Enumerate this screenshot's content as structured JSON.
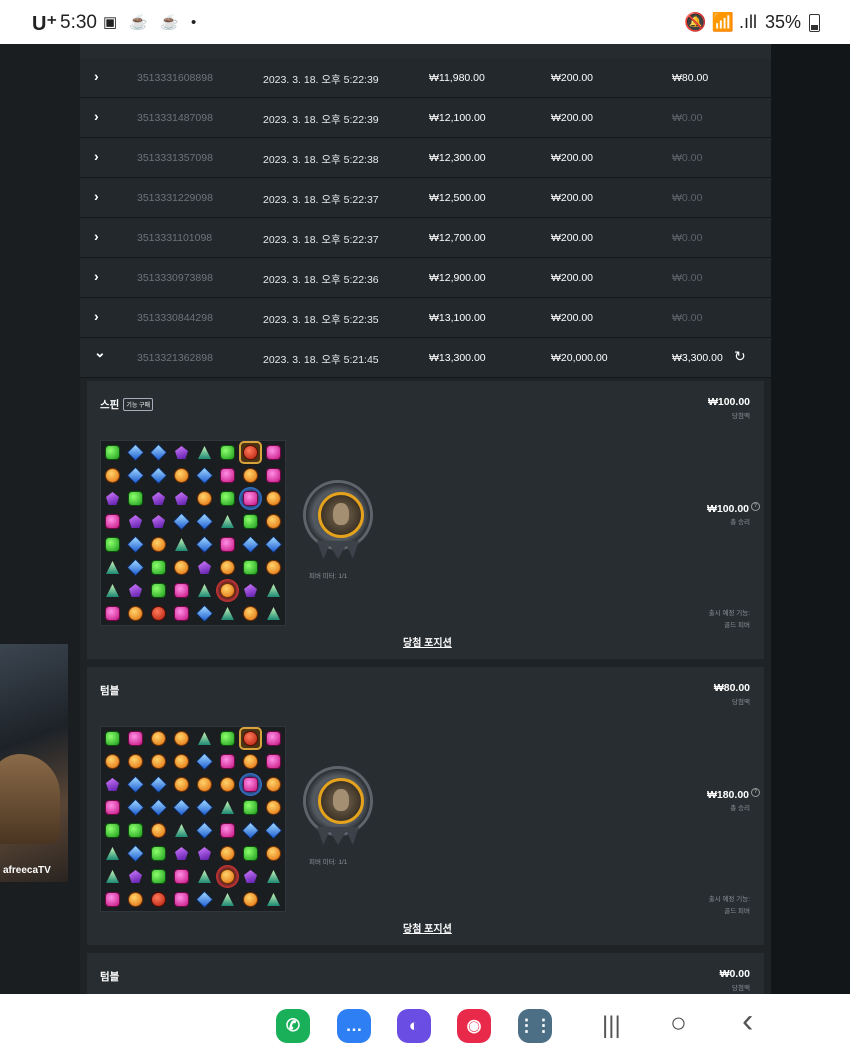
{
  "status_bar": {
    "carrier": "U⁺",
    "time": "5:30",
    "icons": "▣ ☕ ☕ •",
    "right_icons": "🔕 📶 .ıll",
    "battery": "35%"
  },
  "video_overlay": {
    "brand": "afreecaTV"
  },
  "transactions": [
    {
      "id": "3513331608898",
      "date": "2023. 3. 18. 오후 5:22:39",
      "bet": "₩11,980.00",
      "win": "₩200.00",
      "profit": "₩80.00",
      "expanded": false
    },
    {
      "id": "3513331487098",
      "date": "2023. 3. 18. 오후 5:22:39",
      "bet": "₩12,100.00",
      "win": "₩200.00",
      "profit": "₩0.00",
      "expanded": false
    },
    {
      "id": "3513331357098",
      "date": "2023. 3. 18. 오후 5:22:38",
      "bet": "₩12,300.00",
      "win": "₩200.00",
      "profit": "₩0.00",
      "expanded": false
    },
    {
      "id": "3513331229098",
      "date": "2023. 3. 18. 오후 5:22:37",
      "bet": "₩12,500.00",
      "win": "₩200.00",
      "profit": "₩0.00",
      "expanded": false
    },
    {
      "id": "3513331101098",
      "date": "2023. 3. 18. 오후 5:22:37",
      "bet": "₩12,700.00",
      "win": "₩200.00",
      "profit": "₩0.00",
      "expanded": false
    },
    {
      "id": "3513330973898",
      "date": "2023. 3. 18. 오후 5:22:36",
      "bet": "₩12,900.00",
      "win": "₩200.00",
      "profit": "₩0.00",
      "expanded": false
    },
    {
      "id": "3513330844298",
      "date": "2023. 3. 18. 오후 5:22:35",
      "bet": "₩13,100.00",
      "win": "₩200.00",
      "profit": "₩0.00",
      "expanded": false
    },
    {
      "id": "3513321362898",
      "date": "2023. 3. 18. 오후 5:21:45",
      "bet": "₩13,300.00",
      "win": "₩20,000.00",
      "profit": "₩3,300.00",
      "expanded": true
    }
  ],
  "icons": {
    "collapsed": "chevron-right-icon",
    "expanded": "chevron-down-icon",
    "refresh": "refresh-icon"
  },
  "rounds": [
    {
      "title": "스핀",
      "badge": "기능 구매",
      "win_amount": "₩100.00",
      "win_label": "당첨액",
      "total_amount": "₩100.00",
      "total_label": "총 승리",
      "medal_caption": "피버 미터: 1/1",
      "note_line1": "출시 예정 기능:",
      "note_line2": "골드 피버",
      "link": "당첨 포지션",
      "grid": [
        [
          "green",
          "blue",
          "blue",
          "purple",
          "teal",
          "green",
          "red:gframe",
          "pink"
        ],
        [
          "orange",
          "blue",
          "blue",
          "orange",
          "blue",
          "pink",
          "orange",
          "pink"
        ],
        [
          "purple",
          "green",
          "purple",
          "purple",
          "orange",
          "green",
          "pink:bglow",
          "orange"
        ],
        [
          "pink",
          "purple",
          "purple",
          "blue",
          "blue",
          "teal",
          "green",
          "orange"
        ],
        [
          "green",
          "blue",
          "orange",
          "teal",
          "blue",
          "pink",
          "blue",
          "blue"
        ],
        [
          "teal",
          "blue",
          "green",
          "orange",
          "purple",
          "orange",
          "green",
          "orange"
        ],
        [
          "teal",
          "purple",
          "green",
          "pink",
          "teal",
          "orange:rglow",
          "purple",
          "teal"
        ],
        [
          "pink",
          "orange",
          "red",
          "pink",
          "blue",
          "teal",
          "orange",
          "teal"
        ]
      ]
    },
    {
      "title": "텀블",
      "badge": "",
      "win_amount": "₩80.00",
      "win_label": "당첨액",
      "total_amount": "₩180.00",
      "total_label": "총 승리",
      "medal_caption": "피버 미터: 1/1",
      "note_line1": "출시 예정 기능:",
      "note_line2": "골드 피버",
      "link": "당첨 포지션",
      "grid": [
        [
          "green",
          "pink",
          "orange",
          "orange",
          "teal",
          "green",
          "red:gframe",
          "pink"
        ],
        [
          "orange",
          "orange",
          "orange",
          "orange",
          "blue",
          "pink",
          "orange",
          "pink"
        ],
        [
          "purple",
          "blue",
          "blue",
          "orange",
          "orange",
          "orange",
          "pink:bglow",
          "orange"
        ],
        [
          "pink",
          "blue",
          "blue",
          "blue",
          "blue",
          "teal",
          "green",
          "orange"
        ],
        [
          "green",
          "green",
          "orange",
          "teal",
          "blue",
          "pink",
          "blue",
          "blue"
        ],
        [
          "teal",
          "blue",
          "green",
          "purple",
          "purple",
          "orange",
          "green",
          "orange"
        ],
        [
          "teal",
          "purple",
          "green",
          "pink",
          "teal",
          "orange:rglow",
          "purple",
          "teal"
        ],
        [
          "pink",
          "orange",
          "red",
          "pink",
          "blue",
          "teal",
          "orange",
          "teal"
        ]
      ]
    },
    {
      "title": "텀블",
      "win_amount": "₩0.00",
      "win_label": "당첨액"
    }
  ],
  "nav": {
    "apps": [
      {
        "name": "phone-app-icon",
        "glyph": "✆",
        "color": "#1ab05a"
      },
      {
        "name": "messages-app-icon",
        "glyph": "…",
        "color": "#2d7ff3"
      },
      {
        "name": "internet-app-icon",
        "glyph": "◐",
        "color": "#6a4de3"
      },
      {
        "name": "camera-app-icon",
        "glyph": "◉",
        "color": "#e8294a"
      },
      {
        "name": "apps-drawer-icon",
        "glyph": "⋮⋮",
        "color": "#4c6f86"
      }
    ],
    "recents": "|||",
    "home": "○",
    "back": "‹"
  }
}
